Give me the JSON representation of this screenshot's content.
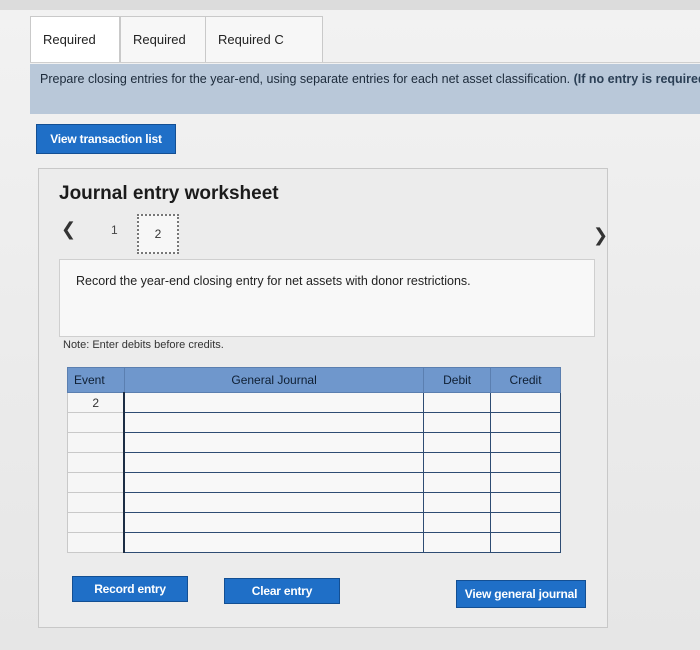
{
  "tabs": [
    {
      "label": "Required A",
      "active": true
    },
    {
      "label": "Required B",
      "active": false
    },
    {
      "label": "Required C",
      "active": false
    }
  ],
  "instructions": {
    "main": "Prepare closing entries for the year-end, using separate entries for each net asset classification.",
    "note": "(If no entry is required for a transaction/event, select \"No Journal Entry Required\" in the first account field.)"
  },
  "buttons": {
    "view_transaction_list": "View transaction list",
    "record_entry": "Record entry",
    "clear_entry": "Clear entry",
    "view_general_journal": "View general journal"
  },
  "worksheet": {
    "title": "Journal entry worksheet",
    "pages": [
      "1",
      "2"
    ],
    "current_page": "2",
    "prompt": "Record the year-end closing entry for net assets with donor restrictions.",
    "note": "Note: Enter debits before credits."
  },
  "journal": {
    "headers": {
      "event": "Event",
      "general_journal": "General Journal",
      "debit": "Debit",
      "credit": "Credit"
    },
    "rows": [
      {
        "event": "2"
      },
      {
        "event": ""
      },
      {
        "event": ""
      },
      {
        "event": ""
      },
      {
        "event": ""
      },
      {
        "event": ""
      },
      {
        "event": ""
      },
      {
        "event": ""
      }
    ]
  },
  "colors": {
    "accent": "#1f6fc7",
    "instruction_bg": "#b9c8d9",
    "table_header": "#6f97cc"
  }
}
